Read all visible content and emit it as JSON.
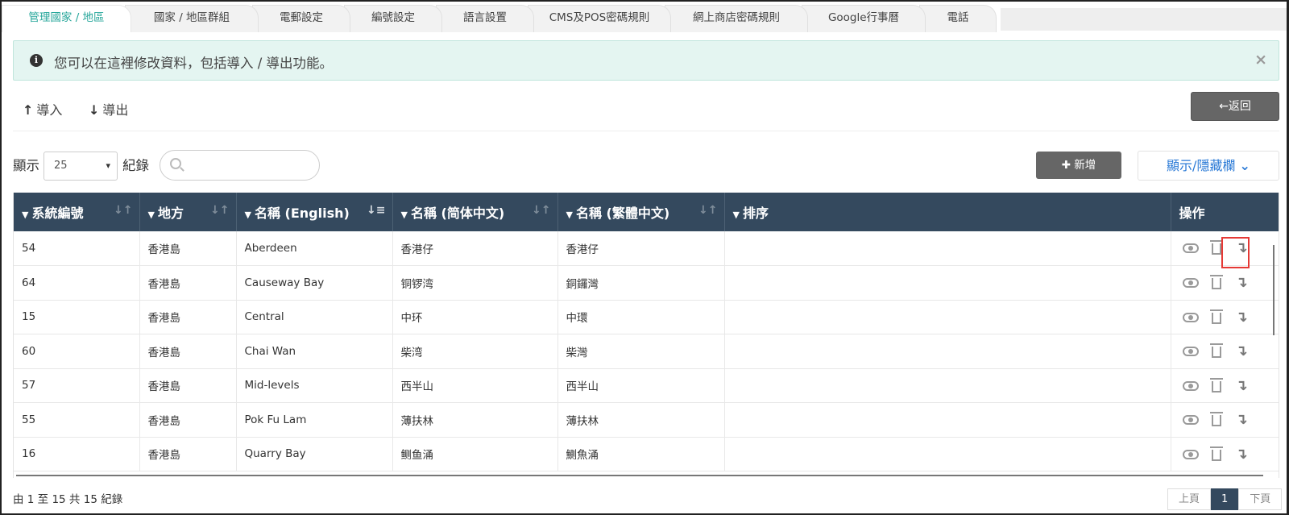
{
  "tabs": [
    {
      "label": "管理國家 / 地區",
      "active": true
    },
    {
      "label": "國家 / 地區群組"
    },
    {
      "label": "電郵設定"
    },
    {
      "label": "編號設定"
    },
    {
      "label": "語言設置"
    },
    {
      "label": "CMS及POS密碼規則"
    },
    {
      "label": "網上商店密碼規則"
    },
    {
      "label": "Google行事曆"
    },
    {
      "label": "電話"
    }
  ],
  "alert": {
    "text": "您可以在這裡修改資料，包括導入 / 導出功能。",
    "close": "×"
  },
  "toolbar": {
    "import": "導入",
    "export": "導出",
    "back": "返回",
    "add": "新增",
    "columns": "顯示/隱藏欄"
  },
  "length": {
    "prefix": "顯示",
    "value": "25",
    "suffix": "紀錄"
  },
  "search": {
    "placeholder": ""
  },
  "table": {
    "headers": [
      "系統編號",
      "地方",
      "名稱 (English)",
      "名稱 (简体中文)",
      "名稱 (繁體中文)",
      "排序",
      "操作"
    ],
    "rows": [
      [
        "54",
        "香港島",
        "Aberdeen",
        "香港仔",
        "香港仔",
        ""
      ],
      [
        "64",
        "香港島",
        "Causeway Bay",
        "铜锣湾",
        "銅鑼灣",
        ""
      ],
      [
        "15",
        "香港島",
        "Central",
        "中环",
        "中環",
        ""
      ],
      [
        "60",
        "香港島",
        "Chai Wan",
        "柴湾",
        "柴灣",
        ""
      ],
      [
        "57",
        "香港島",
        "Mid-levels",
        "西半山",
        "西半山",
        ""
      ],
      [
        "55",
        "香港島",
        "Pok Fu Lam",
        "薄扶林",
        "薄扶林",
        ""
      ],
      [
        "16",
        "香港島",
        "Quarry Bay",
        "鲗鱼涌",
        "鰂魚涌",
        ""
      ]
    ]
  },
  "footer": {
    "info": "由 1 至 15 共 15 紀錄",
    "prev": "上頁",
    "page": "1",
    "next": "下頁"
  }
}
